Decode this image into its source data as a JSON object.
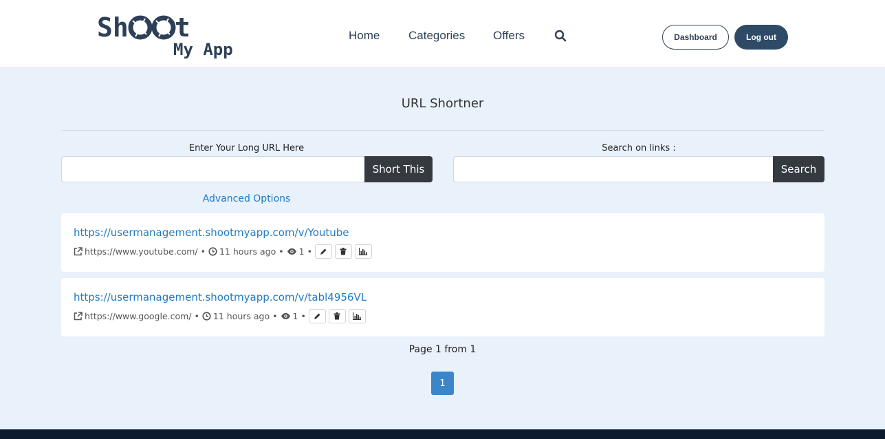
{
  "header": {
    "logo_line1": "ShOOt",
    "logo_line2": "My App",
    "nav": [
      {
        "label": "Home"
      },
      {
        "label": "Categories"
      },
      {
        "label": "Offers"
      }
    ],
    "search_icon": "search-icon",
    "dashboard_label": "Dashboard",
    "logout_label": "Log out"
  },
  "main": {
    "title": "URL Shortner",
    "shorten": {
      "label": "Enter Your Long URL Here",
      "value": "",
      "button": "Short This",
      "advanced": "Advanced Options"
    },
    "search": {
      "label": "Search on links :",
      "value": "",
      "button": "Search"
    },
    "links": [
      {
        "short_url": "https://usermanagement.shootmyapp.com/v/Youtube",
        "long_url": "https://www.youtube.com/",
        "time": "11 hours ago",
        "views": "1"
      },
      {
        "short_url": "https://usermanagement.shootmyapp.com/v/tabl4956VL",
        "long_url": "https://www.google.com/",
        "time": "11 hours ago",
        "views": "1"
      }
    ],
    "page_info": "Page 1 from 1",
    "current_page": "1"
  },
  "colors": {
    "navy": "#2e4057",
    "link": "#1f7ac4",
    "page_active": "#3a86c8",
    "button_dark": "#343a40",
    "background": "#e9f1fb",
    "footer": "#0c1c2e"
  }
}
